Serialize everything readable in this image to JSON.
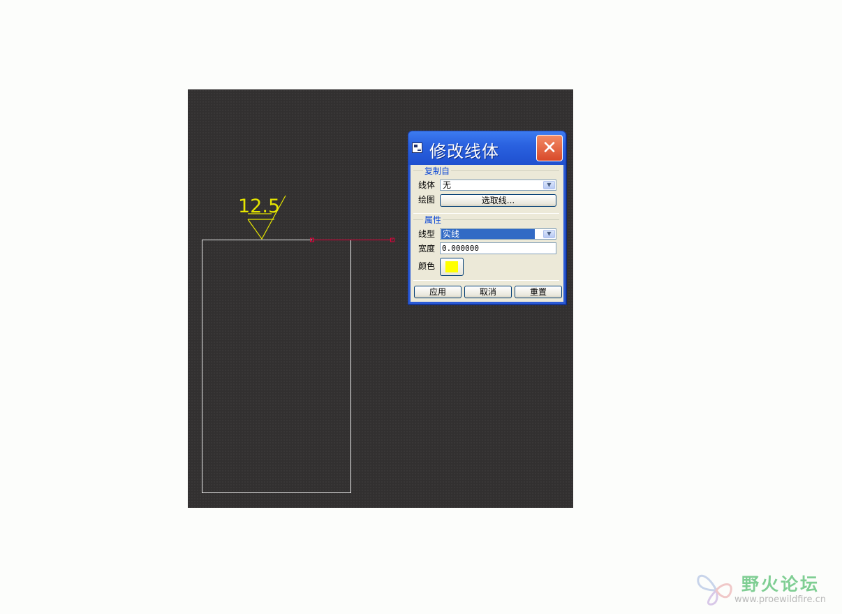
{
  "drawing": {
    "roughness_value": "12.5",
    "colors": {
      "canvas_bg": "#323030",
      "part_outline": "#f0f0f0",
      "symbol": "#e6e600",
      "selected_line": "#e8003c"
    }
  },
  "dialog": {
    "title": "修改线体",
    "close_icon": "close-icon",
    "copy_from_group": {
      "label": "复制自",
      "line_style_label": "线体",
      "line_style_value": "无",
      "drawing_label": "绘图",
      "select_line_button": "选取线..."
    },
    "attributes_group": {
      "label": "属性",
      "line_type_label": "线型",
      "line_type_value": "实线",
      "width_label": "宽度",
      "width_value": "0.000000",
      "color_label": "颜色",
      "color_value": "#ffff00"
    },
    "buttons": {
      "apply": "应用",
      "cancel": "取消",
      "reset": "重置"
    }
  },
  "watermark": {
    "title": "野火论坛",
    "url": "www.proewildfire.cn"
  }
}
